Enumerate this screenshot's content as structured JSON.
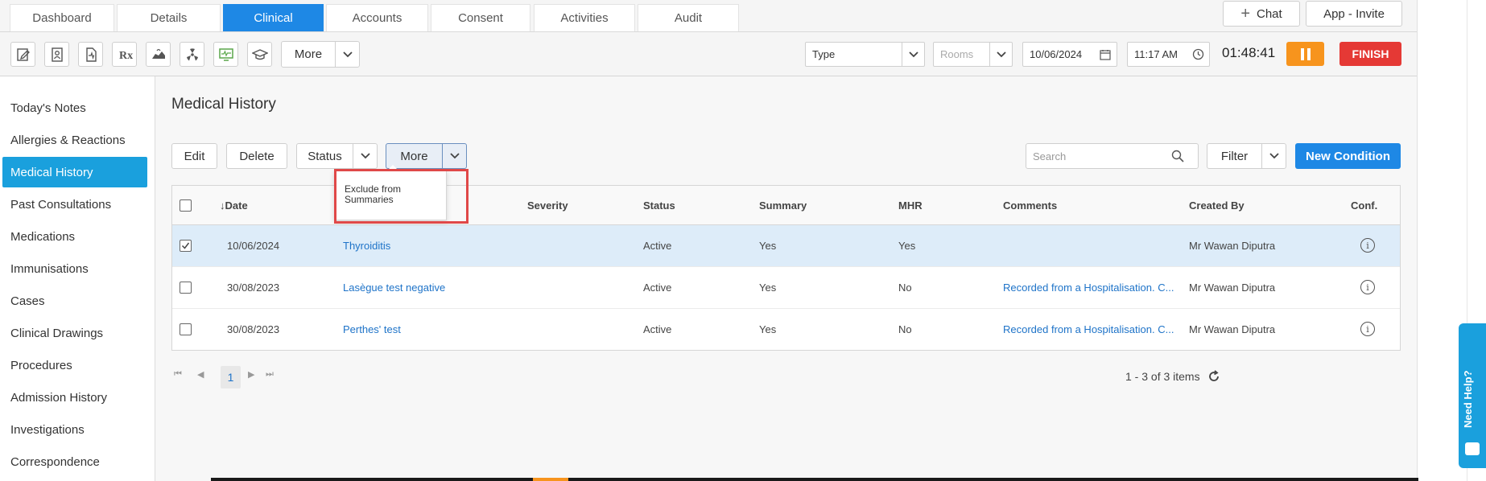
{
  "tabs": [
    {
      "label": "Dashboard",
      "active": false
    },
    {
      "label": "Details",
      "active": false
    },
    {
      "label": "Clinical",
      "active": true
    },
    {
      "label": "Accounts",
      "active": false
    },
    {
      "label": "Consent",
      "active": false
    },
    {
      "label": "Activities",
      "active": false
    },
    {
      "label": "Audit",
      "active": false
    }
  ],
  "top_buttons": {
    "chat": "Chat",
    "app_invite": "App - Invite"
  },
  "toolbar": {
    "icons": [
      "notes-icon",
      "patient-file-icon",
      "document-chart-icon",
      "prescription-icon",
      "hands-icon",
      "radiation-icon",
      "monitor-icon",
      "graduation-cap-icon"
    ],
    "more_label": "More",
    "type_placeholder": "Type",
    "rooms_placeholder": "Rooms",
    "date_value": "10/06/2024",
    "time_value": "11:17 AM",
    "timer": "01:48:41",
    "finish_label": "FINISH",
    "pause_color": "#f7941d",
    "finish_color": "#e53935"
  },
  "sidebar": {
    "items": [
      {
        "label": "Today's Notes",
        "active": false
      },
      {
        "label": "Allergies & Reactions",
        "active": false
      },
      {
        "label": "Medical History",
        "active": true
      },
      {
        "label": "Past Consultations",
        "active": false
      },
      {
        "label": "Medications",
        "active": false
      },
      {
        "label": "Immunisations",
        "active": false
      },
      {
        "label": "Cases",
        "active": false
      },
      {
        "label": "Clinical Drawings",
        "active": false
      },
      {
        "label": "Procedures",
        "active": false
      },
      {
        "label": "Admission History",
        "active": false
      },
      {
        "label": "Investigations",
        "active": false
      },
      {
        "label": "Correspondence",
        "active": false
      }
    ]
  },
  "main": {
    "title": "Medical History",
    "actions": {
      "edit": "Edit",
      "delete": "Delete",
      "status": "Status",
      "more": "More",
      "filter": "Filter",
      "new_condition": "New Condition",
      "search_placeholder": "Search"
    },
    "more_menu": {
      "items": [
        "Exclude from Summaries"
      ]
    },
    "table": {
      "headers": {
        "date": "Date",
        "severity": "Severity",
        "status": "Status",
        "summary": "Summary",
        "mhr": "MHR",
        "comments": "Comments",
        "created_by": "Created By",
        "conf": "Conf."
      },
      "rows": [
        {
          "checked": true,
          "date": "10/06/2024",
          "condition": "Thyroiditis",
          "severity": "",
          "status": "Active",
          "summary": "Yes",
          "mhr": "Yes",
          "comments": "",
          "created_by": "Mr Wawan Diputra"
        },
        {
          "checked": false,
          "date": "30/08/2023",
          "condition": "Lasègue test negative",
          "severity": "",
          "status": "Active",
          "summary": "Yes",
          "mhr": "No",
          "comments": "Recorded from a Hospitalisation. C...",
          "created_by": "Mr Wawan Diputra"
        },
        {
          "checked": false,
          "date": "30/08/2023",
          "condition": "Perthes' test",
          "severity": "",
          "status": "Active",
          "summary": "Yes",
          "mhr": "No",
          "comments": "Recorded from a Hospitalisation. C...",
          "created_by": "Mr Wawan Diputra"
        }
      ]
    },
    "pager": {
      "current_page": "1",
      "info": "1 - 3 of 3 items"
    }
  },
  "help_tab": {
    "label": "Need Help?"
  },
  "colors": {
    "accent": "#1e88e5",
    "sidebar_active": "#1aa0dd",
    "link": "#1e73c8",
    "highlight_border": "#e04848"
  }
}
